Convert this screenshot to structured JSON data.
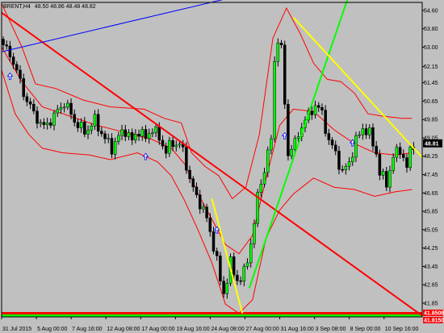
{
  "window": {
    "symbol": "BRENT,H4",
    "quote": "48.50 48.86 48.48 48.82"
  },
  "colors": {
    "background": "#c0c0c0",
    "frame": "#000000",
    "bull_candle": "#00ff00",
    "bear_candle": "#000000",
    "bands": "#ff0000",
    "trend_red": "#ff0000",
    "trend_green": "#00ff00",
    "trend_yellow": "#ffff00",
    "trend_blue": "#0000ff",
    "arrow": "#0000ff",
    "price_badge": "#000000",
    "price_badge_text": "#ffffff",
    "level_badge": "#ff0000"
  },
  "chart_data": {
    "type": "candlestick",
    "symbol": "BRENT",
    "timeframe": "H4",
    "ylim": [
      41.25,
      54.95
    ],
    "y_ticks": [
      "54.60",
      "53.80",
      "53.00",
      "52.15",
      "51.45",
      "50.65",
      "49.85",
      "49.05",
      "48.25",
      "47.45",
      "46.65",
      "45.85",
      "45.05",
      "44.25",
      "43.45",
      "42.65",
      "41.85"
    ],
    "x_ticks": [
      "31 Jul 2015",
      "5 Aug 00:00",
      "7 Aug 16:00",
      "12 Aug 08:00",
      "17 Aug 00:00",
      "19 Aug 16:00",
      "24 Aug 08:00",
      "27 Aug 00:00",
      "31 Aug 16:00",
      "3 Sep 08:00",
      "8 Sep 00:00",
      "10 Sep 16:00"
    ],
    "current_price": "48.81",
    "level_labels": [
      "41.8508",
      "41.8150"
    ],
    "close_path": [
      [
        0,
        53.1
      ],
      [
        3,
        52.4
      ],
      [
        6,
        51.0
      ],
      [
        9,
        50.1
      ],
      [
        12,
        49.5
      ],
      [
        15,
        50.0
      ],
      [
        18,
        50.6
      ],
      [
        21,
        49.8
      ],
      [
        24,
        49.3
      ],
      [
        27,
        49.8
      ],
      [
        30,
        49.0
      ],
      [
        32,
        48.6
      ],
      [
        34,
        49.1
      ],
      [
        36,
        49.4
      ],
      [
        38,
        48.9
      ],
      [
        40,
        49.4
      ],
      [
        42,
        49.0
      ],
      [
        44,
        49.5
      ],
      [
        46,
        49.0
      ],
      [
        48,
        48.5
      ],
      [
        50,
        48.8
      ],
      [
        52,
        48.8
      ],
      [
        53,
        48.4
      ],
      [
        55,
        47.3
      ],
      [
        57,
        46.4
      ],
      [
        59,
        46.0
      ],
      [
        61,
        44.9
      ],
      [
        63,
        43.8
      ],
      [
        64,
        42.7
      ],
      [
        65,
        42.3
      ],
      [
        66,
        42.9
      ],
      [
        67,
        43.7
      ],
      [
        68,
        43.0
      ],
      [
        70,
        42.9
      ],
      [
        72,
        43.6
      ],
      [
        73,
        44.6
      ],
      [
        74,
        45.3
      ],
      [
        75,
        46.5
      ],
      [
        77,
        47.7
      ],
      [
        78,
        48.4
      ],
      [
        79,
        48.9
      ],
      [
        80,
        52.5
      ],
      [
        81,
        53.3
      ],
      [
        82,
        52.9
      ],
      [
        83,
        50.5
      ],
      [
        84,
        48.4
      ],
      [
        86,
        48.8
      ],
      [
        88,
        49.6
      ],
      [
        90,
        50.0
      ],
      [
        92,
        50.5
      ],
      [
        94,
        50.1
      ],
      [
        96,
        48.9
      ],
      [
        98,
        48.4
      ],
      [
        100,
        47.5
      ],
      [
        102,
        48.0
      ],
      [
        104,
        48.9
      ],
      [
        106,
        49.5
      ],
      [
        108,
        49.2
      ],
      [
        110,
        48.4
      ],
      [
        111,
        47.5
      ],
      [
        113,
        47.1
      ],
      [
        115,
        48.2
      ],
      [
        117,
        48.6
      ],
      [
        119,
        47.7
      ],
      [
        120,
        48.5
      ],
      [
        121,
        48.82
      ]
    ],
    "series": [
      {
        "label": "Bollinger upper",
        "points": [
          [
            0,
            54.9
          ],
          [
            6,
            53.0
          ],
          [
            10,
            51.4
          ],
          [
            16,
            51.2
          ],
          [
            24,
            50.7
          ],
          [
            32,
            50.4
          ],
          [
            42,
            50.3
          ],
          [
            48,
            49.9
          ],
          [
            53,
            49.7
          ],
          [
            56,
            48.4
          ],
          [
            60,
            47.8
          ],
          [
            64,
            47.4
          ],
          [
            68,
            46.4
          ],
          [
            72,
            46.9
          ],
          [
            76,
            49.2
          ],
          [
            80,
            53.4
          ],
          [
            84,
            54.7
          ],
          [
            88,
            53.6
          ],
          [
            92,
            52.3
          ],
          [
            96,
            51.6
          ],
          [
            100,
            51.5
          ],
          [
            104,
            51.0
          ],
          [
            108,
            50.1
          ],
          [
            112,
            50.0
          ],
          [
            118,
            49.9
          ],
          [
            121,
            49.9
          ]
        ]
      },
      {
        "label": "Bollinger middle",
        "points": [
          [
            0,
            53.0
          ],
          [
            6,
            51.5
          ],
          [
            12,
            50.4
          ],
          [
            20,
            50.0
          ],
          [
            28,
            49.6
          ],
          [
            36,
            49.3
          ],
          [
            44,
            49.0
          ],
          [
            50,
            48.6
          ],
          [
            54,
            47.9
          ],
          [
            58,
            46.6
          ],
          [
            62,
            45.5
          ],
          [
            66,
            44.4
          ],
          [
            70,
            44.0
          ],
          [
            74,
            44.8
          ],
          [
            78,
            47.3
          ],
          [
            82,
            49.6
          ],
          [
            86,
            50.3
          ],
          [
            92,
            50.2
          ],
          [
            98,
            49.4
          ],
          [
            104,
            48.8
          ],
          [
            110,
            48.4
          ],
          [
            116,
            48.3
          ],
          [
            121,
            48.4
          ]
        ]
      },
      {
        "label": "Bollinger lower",
        "points": [
          [
            0,
            52.0
          ],
          [
            4,
            50.1
          ],
          [
            8,
            49.2
          ],
          [
            12,
            48.6
          ],
          [
            18,
            48.4
          ],
          [
            26,
            48.3
          ],
          [
            32,
            48.1
          ],
          [
            40,
            48.4
          ],
          [
            46,
            48.0
          ],
          [
            50,
            47.4
          ],
          [
            54,
            46.3
          ],
          [
            58,
            45.0
          ],
          [
            62,
            43.6
          ],
          [
            66,
            41.8
          ],
          [
            70,
            41.4
          ],
          [
            74,
            42.0
          ],
          [
            78,
            44.7
          ],
          [
            82,
            45.9
          ],
          [
            86,
            46.6
          ],
          [
            92,
            47.3
          ],
          [
            98,
            46.9
          ],
          [
            104,
            46.8
          ],
          [
            110,
            46.5
          ],
          [
            116,
            46.7
          ],
          [
            121,
            46.8
          ]
        ]
      }
    ],
    "trendlines": [
      {
        "color": "red",
        "from": [
          0,
          54.5
        ],
        "to": [
          124,
          41.3
        ]
      },
      {
        "color": "blue",
        "from": [
          0,
          52.8
        ],
        "to": [
          66,
          55.1
        ]
      },
      {
        "color": "green",
        "from": [
          73,
          42.5
        ],
        "to": [
          102,
          55.1
        ]
      },
      {
        "color": "yellow",
        "from": [
          86,
          54.3
        ],
        "to": [
          124,
          48.2
        ]
      },
      {
        "color": "yellow",
        "from": [
          62,
          46.4
        ],
        "to": [
          71,
          41.4
        ]
      }
    ],
    "arrows": [
      [
        2,
        51.7
      ],
      [
        42,
        48.2
      ],
      [
        63,
        45.0
      ],
      [
        83,
        49.1
      ],
      [
        103,
        48.8
      ]
    ]
  }
}
